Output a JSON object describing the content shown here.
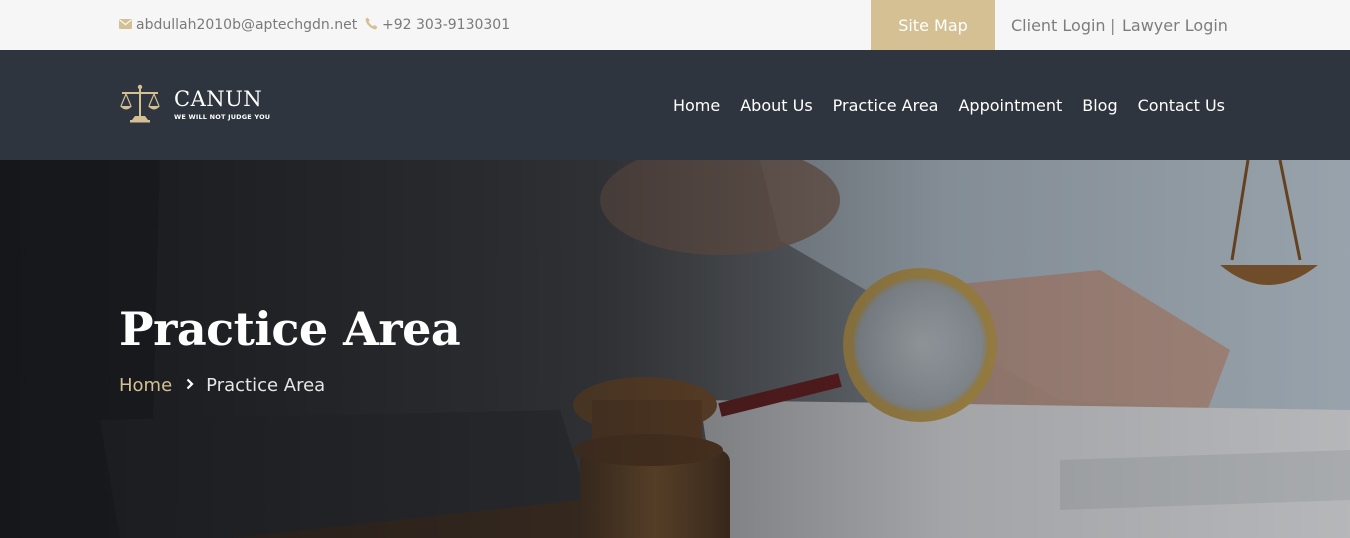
{
  "topbar": {
    "email": "abdullah2010b@aptechgdn.net",
    "phone": "+92 303-9130301",
    "site_map": "Site Map",
    "client_login": "Client Login",
    "separator": "|",
    "lawyer_login": "Lawyer Login"
  },
  "brand": {
    "name": "CANUN",
    "tagline": "WE WILL NOT JUDGE YOU"
  },
  "nav": {
    "items": [
      "Home",
      "About Us",
      "Practice Area",
      "Appointment",
      "Blog",
      "Contact Us"
    ]
  },
  "hero": {
    "title": "Practice Area",
    "breadcrumb_home": "Home",
    "breadcrumb_current": "Practice Area"
  },
  "colors": {
    "accent": "#d4c093",
    "nav_bg": "#2f353e",
    "topbar_bg": "#f6f6f6"
  }
}
